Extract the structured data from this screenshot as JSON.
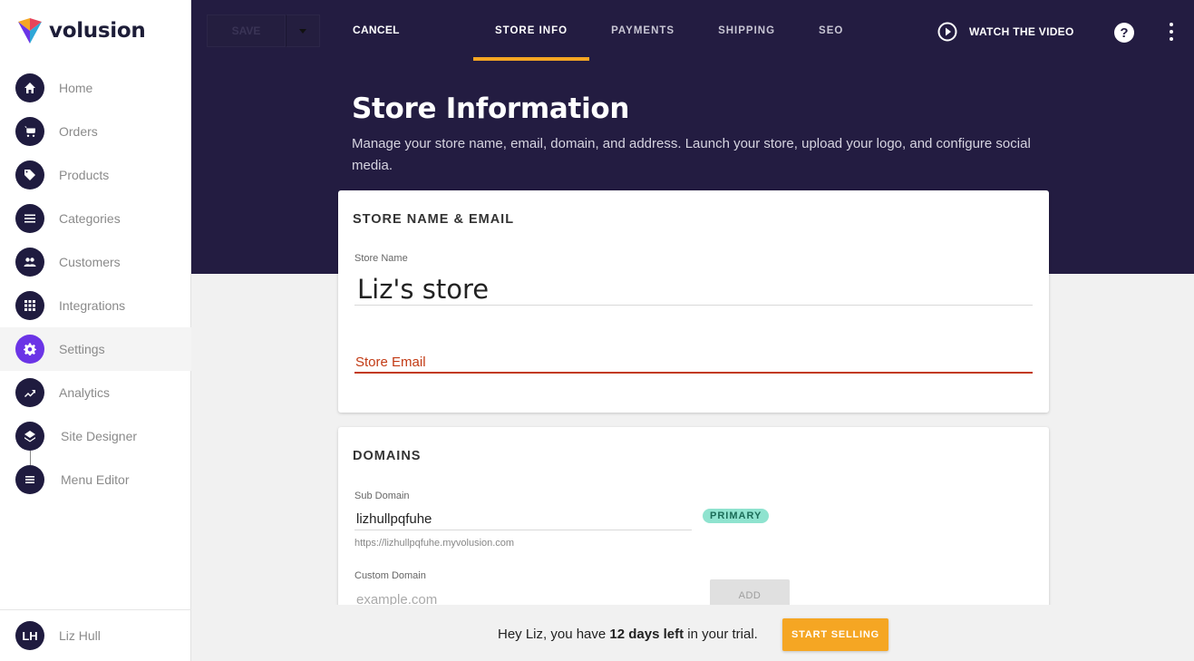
{
  "brand": {
    "name": "volusion"
  },
  "sidebar": {
    "items": [
      {
        "label": "Home",
        "icon": "home-icon"
      },
      {
        "label": "Orders",
        "icon": "cart-icon"
      },
      {
        "label": "Products",
        "icon": "tag-icon"
      },
      {
        "label": "Categories",
        "icon": "list-icon"
      },
      {
        "label": "Customers",
        "icon": "people-icon"
      },
      {
        "label": "Integrations",
        "icon": "grid-icon"
      },
      {
        "label": "Settings",
        "icon": "gear-icon",
        "active": true
      },
      {
        "label": "Analytics",
        "icon": "trending-icon"
      },
      {
        "label": "Site Designer",
        "icon": "layers-icon"
      },
      {
        "label": "Menu Editor",
        "icon": "menu-icon"
      }
    ],
    "user": {
      "initials": "LH",
      "name": "Liz Hull"
    }
  },
  "toolbar": {
    "save_label": "SAVE",
    "cancel_label": "CANCEL",
    "tabs": [
      {
        "label": "STORE INFO",
        "active": true
      },
      {
        "label": "PAYMENTS"
      },
      {
        "label": "SHIPPING"
      },
      {
        "label": "SEO"
      }
    ],
    "watch_label": "WATCH THE VIDEO",
    "help_label": "?"
  },
  "header": {
    "title": "Store Information",
    "description": "Manage your store name, email, domain, and address. Launch your store, upload your logo, and configure social media."
  },
  "store_card": {
    "title": "STORE NAME & EMAIL",
    "name_label": "Store Name",
    "name_value": "Liz's store",
    "email_placeholder": "Store Email"
  },
  "domains_card": {
    "title": "DOMAINS",
    "sub_label": "Sub Domain",
    "sub_value": "lizhullpqfuhe",
    "badge": "PRIMARY",
    "sub_url": "https://lizhullpqfuhe.myvolusion.com",
    "custom_label": "Custom Domain",
    "custom_placeholder": "example.com",
    "add_label": "ADD"
  },
  "trial": {
    "prefix": "Hey Liz, you have ",
    "days": "12 days left",
    "suffix": " in your trial.",
    "button": "START SELLING"
  },
  "colors": {
    "header_bg": "#231c41",
    "accent": "#f5a623",
    "active_nav": "#6b34e6",
    "error": "#c23a14",
    "badge": "#8fe3cf"
  }
}
